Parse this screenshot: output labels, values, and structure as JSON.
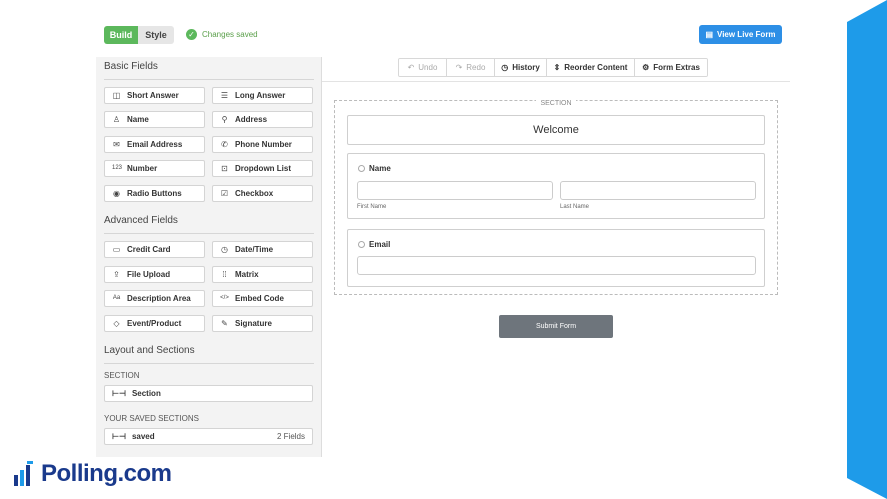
{
  "header": {
    "build_tab": "Build",
    "style_tab": "Style",
    "saved_status": "Changes saved",
    "view_live_button": "View Live Form"
  },
  "sidebar": {
    "basic_title": "Basic Fields",
    "basic_fields": [
      "Short Answer",
      "Long Answer",
      "Name",
      "Address",
      "Email Address",
      "Phone Number",
      "Number",
      "Dropdown List",
      "Radio Buttons",
      "Checkbox"
    ],
    "advanced_title": "Advanced Fields",
    "advanced_fields": [
      "Credit Card",
      "Date/Time",
      "File Upload",
      "Matrix",
      "Description Area",
      "Embed Code",
      "Event/Product",
      "Signature"
    ],
    "layout_title": "Layout and Sections",
    "section_caption": "SECTION",
    "section_item": "Section",
    "saved_caption": "YOUR SAVED SECTIONS",
    "saved_item": "saved",
    "saved_count": "2 Fields"
  },
  "toolbar": {
    "undo": "Undo",
    "redo": "Redo",
    "history": "History",
    "reorder": "Reorder Content",
    "extras": "Form Extras"
  },
  "form": {
    "section_label": "SECTION",
    "welcome": "Welcome",
    "name_label": "Name",
    "first_name": "First Name",
    "last_name": "Last Name",
    "email_label": "Email",
    "submit": "Submit Form"
  },
  "brand": {
    "logo_text": "Polling.com"
  },
  "colors": {
    "accent_green": "#5cb85c",
    "accent_blue": "#2d8fe6",
    "brand_navy": "#1a3a8c",
    "side_blue": "#1e9be9"
  }
}
